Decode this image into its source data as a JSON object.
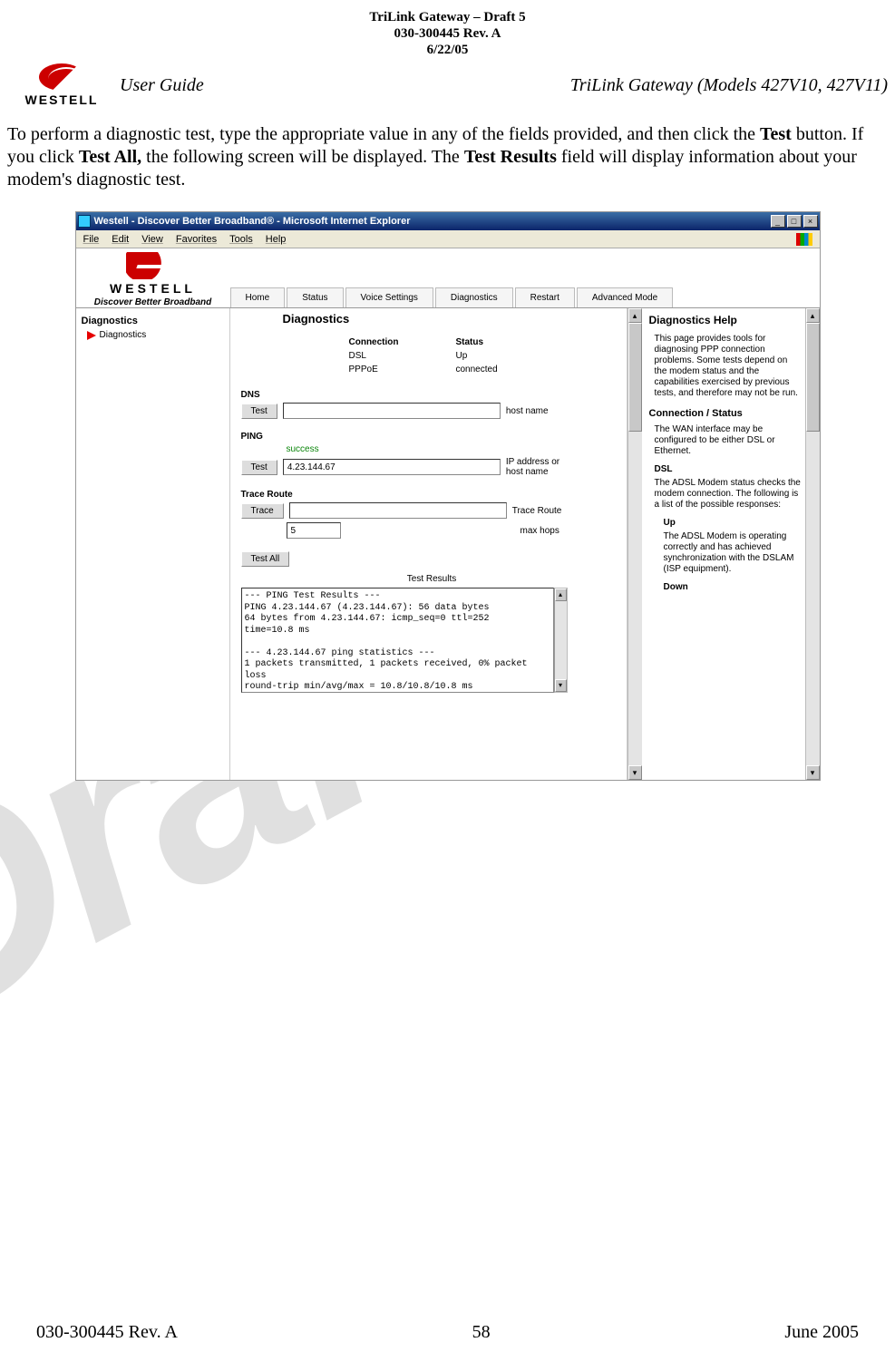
{
  "doc": {
    "header_line1": "TriLink Gateway – Draft 5",
    "header_line2": "030-300445 Rev. A",
    "header_line3": "6/22/05",
    "guide_left": "User Guide",
    "guide_right": "TriLink Gateway (Models 427V10, 427V11)",
    "body_p1_a": "To perform a diagnostic test, type the appropriate value in any of the fields provided, and then click the ",
    "body_p1_b": "Test",
    "body_p1_c": " button. If you click ",
    "body_p1_d": "Test All,",
    "body_p1_e": " the following screen will be displayed. The ",
    "body_p1_f": "Test Results",
    "body_p1_g": " field will display information about your modem's diagnostic test.",
    "watermark": "Draft",
    "logo_brand": "WESTELL"
  },
  "footer": {
    "left": "030-300445 Rev. A",
    "center": "58",
    "right": "June 2005"
  },
  "browser": {
    "title": "Westell - Discover Better Broadband® - Microsoft Internet Explorer",
    "btn_min": "_",
    "btn_max": "□",
    "btn_close": "×",
    "menu": [
      "File",
      "Edit",
      "View",
      "Favorites",
      "Tools",
      "Help"
    ]
  },
  "app": {
    "brand": "WESTELL",
    "tagline": "Discover Better Broadband",
    "nav": [
      "Home",
      "Status",
      "Voice Settings",
      "Diagnostics",
      "Restart",
      "Advanced Mode"
    ]
  },
  "sidebar": {
    "heading": "Diagnostics",
    "items": [
      "Diagnostics"
    ]
  },
  "center": {
    "title": "Diagnostics",
    "conn_h1": "Connection",
    "conn_h2": "Status",
    "rows": [
      {
        "c1": "DSL",
        "c2": "Up"
      },
      {
        "c1": "PPPoE",
        "c2": "connected"
      }
    ],
    "dns": {
      "head": "DNS",
      "btn": "Test",
      "value": "",
      "label": "host name"
    },
    "ping": {
      "head": "PING",
      "btn": "Test",
      "status": "success",
      "value": "4.23.144.67",
      "label": "IP address or host name"
    },
    "trace": {
      "head": "Trace Route",
      "btn": "Trace",
      "value": "",
      "label1": "Trace Route",
      "hops_value": "5",
      "label2": "max hops"
    },
    "testall": "Test All",
    "results_title": "Test Results",
    "results": "--- PING Test Results ---\nPING 4.23.144.67 (4.23.144.67): 56 data bytes\n64 bytes from 4.23.144.67: icmp_seq=0 ttl=252\ntime=10.8 ms\n\n--- 4.23.144.67 ping statistics ---\n1 packets transmitted, 1 packets received, 0% packet\nloss\nround-trip min/avg/max = 10.8/10.8/10.8 ms"
  },
  "help": {
    "title": "Diagnostics Help",
    "p1": "This page provides tools for diagnosing PPP connection problems. Some tests depend on the modem status and the capabilities exercised by previous tests, and therefore may not be run.",
    "sub1": "Connection / Status",
    "p2": "The WAN interface may be configured to be either DSL or Ethernet.",
    "sub_dsl": "DSL",
    "p3": "The ADSL Modem status checks the modem connection. The following is a list of the possible responses:",
    "up": "Up",
    "p4": "The ADSL Modem is operating correctly and has achieved synchronization with the DSLAM (ISP equipment).",
    "down": "Down"
  },
  "scroll": {
    "up": "▴",
    "down": "▾"
  }
}
